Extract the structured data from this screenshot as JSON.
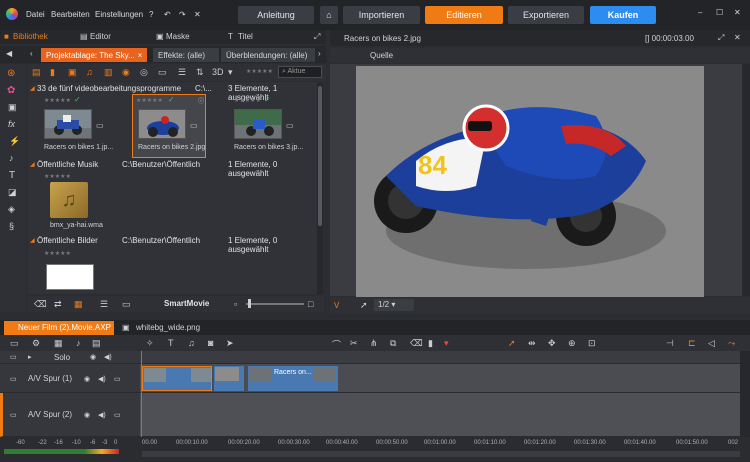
{
  "menu": {
    "items": [
      "Datei",
      "Bearbeiten",
      "Einstellungen"
    ]
  },
  "topnav": {
    "guide": "Anleitung",
    "import": "Importieren",
    "edit": "Editieren",
    "export": "Exportieren",
    "buy": "Kaufen"
  },
  "colors": {
    "accent": "#f07b14",
    "buy": "#2d8cf0",
    "active_tab": "#e8641e"
  },
  "library": {
    "tabs": [
      "Bibliothek",
      "Editor",
      "Maske",
      "Titel"
    ],
    "subtabs": [
      "Projektablage: The Sky...",
      "Effekte: (alle)",
      "Überblendungen: (alle)"
    ],
    "search_placeholder": "Aktue",
    "sections": [
      {
        "title": "33 de fünf videobearbeitungsprogramme",
        "path": "C:\\...",
        "info": "3 Elemente, 1 ausgewählt",
        "items": [
          "Racers on bikes 1.jp...",
          "Racers on bikes 2.jpg",
          "Racers on bikes 3.jp..."
        ]
      },
      {
        "title": "Öffentliche Musik",
        "path": "C:\\Benutzer\\Öffentlich",
        "info": "1 Elemente, 0 ausgewählt",
        "items": [
          "bmx_ya-hai.wma"
        ]
      },
      {
        "title": "Öffentliche Bilder",
        "path": "C:\\Benutzer\\Öffentlich",
        "info": "1 Elemente, 0 ausgewählt",
        "items": [
          ""
        ]
      }
    ],
    "smartmovie": "SmartMovie"
  },
  "preview": {
    "title": "Racers on bikes 2.jpg",
    "timecode": "[] 00:00:03.00",
    "source_tab": "Quelle",
    "page": "1/2",
    "marker": "V"
  },
  "timeline": {
    "tabs": [
      "Neuer Film (2).Movie.AXP",
      "whitebg_wide.png"
    ],
    "solo": "Solo",
    "tracks": [
      "A/V Spur (1)",
      "A/V Spur (2)"
    ],
    "clip_label": "Racers on...",
    "meter": [
      "-60",
      "-22",
      "-16",
      "-10",
      "-6",
      "-3",
      "0"
    ],
    "ruler": [
      "00.00",
      "00:00:10.00",
      "00:00:20.00",
      "00:00:30.00",
      "00:00:40.00",
      "00:00:50.00",
      "00:01:00.00",
      "00:01:10.00",
      "00:01:20.00",
      "00:01:30.00",
      "00:01:40.00",
      "00:01:50.00",
      "002"
    ]
  }
}
